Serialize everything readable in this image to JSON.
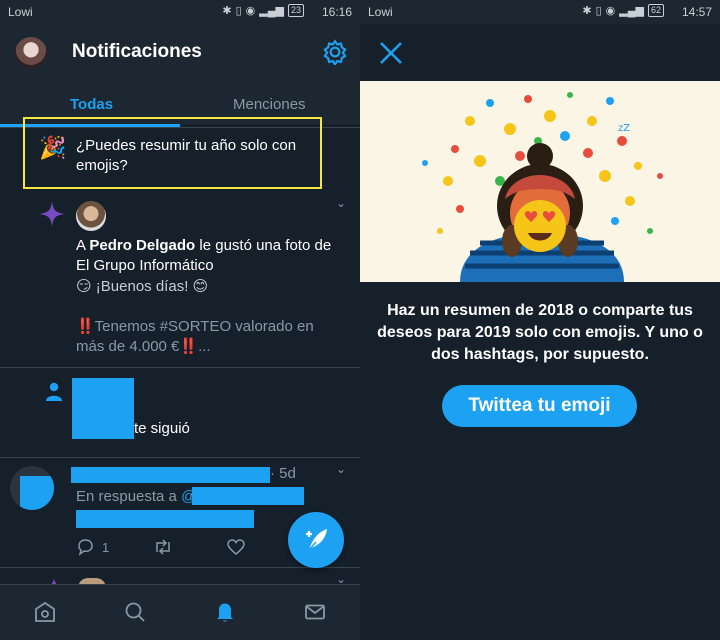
{
  "left_screen": {
    "status_bar": {
      "carrier": "Lowi",
      "battery": "23",
      "time": "16:16"
    },
    "header": {
      "title": "Notificaciones"
    },
    "tabs": [
      {
        "label": "Todas",
        "active": true
      },
      {
        "label": "Menciones",
        "active": false
      }
    ],
    "prompt_card": {
      "text": "¿Puedes resumir tu año solo con emojis?"
    },
    "notifications": {
      "like": {
        "prefix": "A ",
        "user": "Pedro Delgado",
        "text": " le gustó una foto de El Grupo Informático",
        "greeting": "😏 ¡Buenos días! 😊",
        "tweet": "‼️Tenemos #SORTEO valorado en más de 4.000 €‼️..."
      },
      "follow": {
        "text": "te siguió"
      },
      "reply": {
        "time": "· 5d",
        "reply_prefix": "En respuesta a ",
        "at": "@",
        "reply_count": "1"
      }
    }
  },
  "right_screen": {
    "status_bar": {
      "carrier": "Lowi",
      "battery": "62",
      "time": "14:57"
    },
    "promo_text": "Haz un resumen de 2018 o comparte tus deseos para 2019 solo con emojis. Y uno o dos hashtags, por supuesto.",
    "cta_label": "Twittea tu emoji"
  },
  "colors": {
    "accent": "#1da1f2",
    "background": "#15202b",
    "highlight_box": "#f5e642",
    "illustration_bg": "#fbf5e6"
  }
}
